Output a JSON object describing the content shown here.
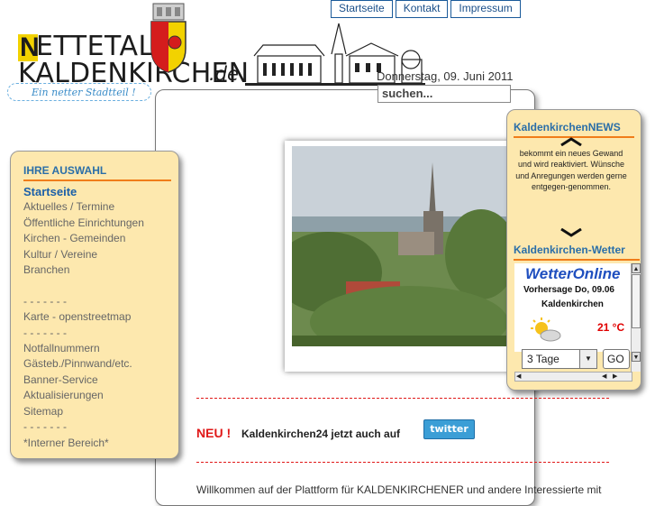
{
  "topnav": {
    "items": [
      "Startseite",
      "Kontakt",
      "Impressum"
    ]
  },
  "logo": {
    "line1": "ETTETAL-",
    "line1_initial": "N",
    "line2": "KALDENKIRCHEN",
    "domain": ".de",
    "slogan": "Ein netter Stadtteil !"
  },
  "header": {
    "date": "Donnerstag, 09. Juni 2011"
  },
  "search": {
    "placeholder": "suchen..."
  },
  "sidebar": {
    "title": "IHRE AUSWAHL",
    "items": [
      "Startseite",
      "Aktuelles / Termine",
      "Öffentliche Einrichtungen",
      "Kirchen - Gemeinden",
      "Kultur / Vereine",
      "Branchen",
      "",
      "- - - - - - -",
      "Karte - openstreetmap",
      "- - - - - - -",
      "Notfallnummern",
      "Gästeb./Pinnwand/etc.",
      "Banner-Service",
      "Aktualisierungen",
      "Sitemap",
      "- - - - - - -",
      "*Interner Bereich*"
    ]
  },
  "news": {
    "title": "KaldenkirchenNEWS",
    "text": "bekommt ein neues Gewand und wird reaktiviert. Wünsche und Anregungen werden gerne entgegen-genommen."
  },
  "weather": {
    "title": "Kaldenkirchen-Wetter",
    "provider": "WetterOnline",
    "forecast": "Vorhersage Do, 09.06",
    "place": "Kaldenkirchen",
    "temp": "21 °C",
    "days_select": "3 Tage",
    "go_label": "GO"
  },
  "content": {
    "neu_label": "NEU !",
    "neu_text": "Kaldenkirchen24 jetzt auch auf",
    "twitter_label": "twitter",
    "welcome": "Willkommen auf der Plattform für KALDENKIRCHENER und andere Interessierte mit"
  },
  "colors": {
    "accent": "#2a6ea8",
    "rule": "#f07d1a",
    "panel": "#fde8ae",
    "alert": "#e01818"
  }
}
